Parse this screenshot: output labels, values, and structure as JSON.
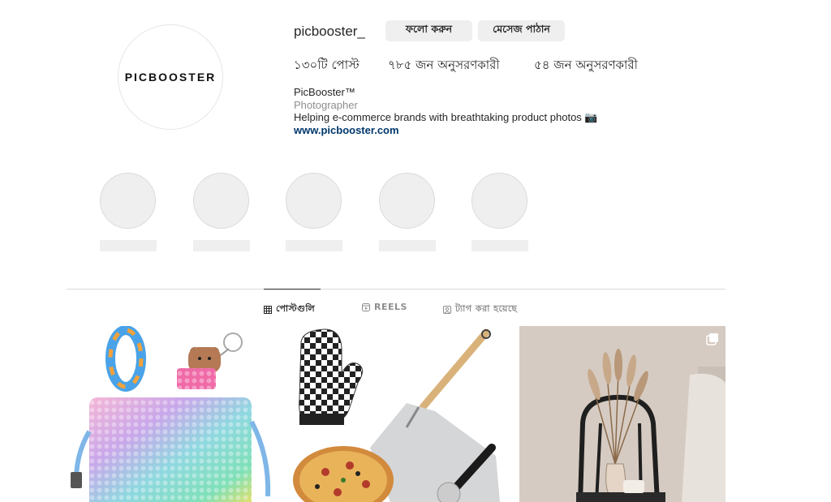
{
  "profile": {
    "username": "picbooster_",
    "avatar_logo": "PICBOOSTER",
    "follow_label": "ফলো করুন",
    "message_label": "মেসেজ পাঠান",
    "stats": {
      "posts": "১৩০টি পোস্ট",
      "followers": "৭৮৫ জন অনুসরণকারী",
      "following": "৫৪ জন অনুসরণকারী"
    },
    "bio": {
      "name": "PicBooster™",
      "category": "Photographer",
      "description": "Helping e-commerce brands with breathtaking product photos 📷",
      "link": "www.picbooster.com"
    }
  },
  "highlights_count": 5,
  "tabs": {
    "posts": "পোস্টগুলি",
    "reels": "REELS",
    "tagged": "ট্যাগ করা হয়েছে"
  },
  "posts": [
    {
      "subject": "pop-it bag and toys"
    },
    {
      "subject": "oven mitt and pizza peel"
    },
    {
      "subject": "pampas grass vase"
    }
  ],
  "colors": {
    "button_bg": "#efefef",
    "link": "#00376b",
    "muted": "#8e8e8e",
    "divider": "#dbdbdb"
  }
}
